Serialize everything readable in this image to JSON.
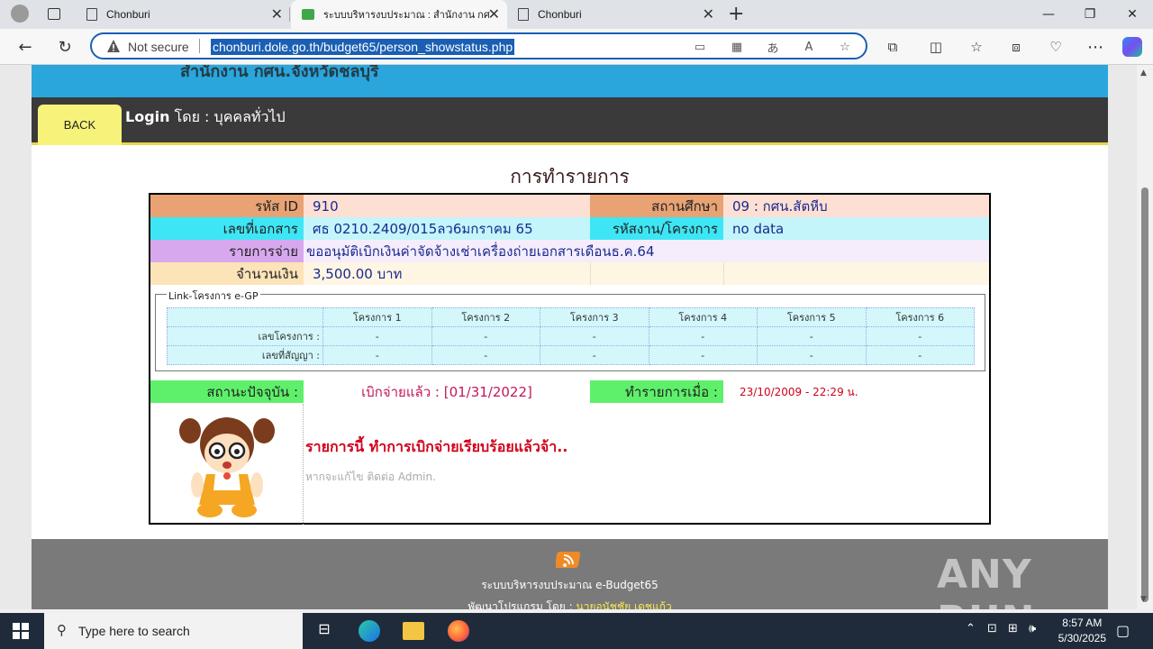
{
  "browser": {
    "tabs": [
      {
        "label": "Chonburi",
        "active": false
      },
      {
        "label": "ระบบบริหารงบประมาณ : สำนักงาน กศ.",
        "active": true
      },
      {
        "label": "Chonburi",
        "active": false
      }
    ],
    "not_secure": "Not secure",
    "url": "chonburi.dole.go.th/budget65/person_showstatus.php"
  },
  "page": {
    "header_partial": "สำนักงาน กศน.จังหวัดชลบุรี",
    "back": "BACK",
    "login_label": "Login",
    "login_by": "โดย : บุคคลทั่วไป",
    "title": "การทำรายการ",
    "fields": {
      "id_label": "รหัส ID",
      "id_value": "910",
      "school_label": "สถานศึกษา",
      "school_value": "09 : กศน.สัตหีบ",
      "doc_label": "เลขที่เอกสาร",
      "doc_value": "ศธ 0210.2409/015ลว6มกราคม 65",
      "project_label": "รหัสงาน/โครงการ",
      "project_value": "no data",
      "expense_label": "รายการจ่าย",
      "expense_value": "ขออนุมัติเบิกเงินค่าจัดจ้างเช่าเครื่องถ่ายเอกสารเดือนธ.ค.64",
      "amount_label": "จำนวนเงิน",
      "amount_value": "3,500.00  บาท"
    },
    "egp": {
      "legend": "Link-โครงการ e-GP",
      "headers": [
        "",
        "โครงการ 1",
        "โครงการ 2",
        "โครงการ 3",
        "โครงการ 4",
        "โครงการ 5",
        "โครงการ 6"
      ],
      "rows": [
        [
          "เลขโครงการ :",
          "-",
          "-",
          "-",
          "-",
          "-",
          "-"
        ],
        [
          "เลขที่สัญญา :",
          "-",
          "-",
          "-",
          "-",
          "-",
          "-"
        ]
      ]
    },
    "status": {
      "label": "สถานะปัจจุบัน :",
      "value": "เบิกจ่ายแล้ว : [01/31/2022]",
      "done_label": "ทำรายการเมื่อ :",
      "done_value": "23/10/2009 - 22:29  น."
    },
    "done_msg": "รายการนี้ ทำการเบิกจ่ายเรียบร้อยแล้วจ้า..",
    "admin_msg": "หากจะแก้ไข ติดต่อ Admin.",
    "footer_line1": "ระบบบริหารงบประมาณ e-Budget65",
    "footer_line2_prefix": "พัฒนาโปรแกรม โดย : ",
    "footer_line2_name": "นายอนัชชัย เดชแก้ว",
    "watermark": "ANY RUN"
  },
  "taskbar": {
    "search_placeholder": "Type here to search",
    "time": "8:57 AM",
    "date": "5/30/2025"
  },
  "colors": {
    "header_blue": "#2aa6dc",
    "label_orange": "#e8a273",
    "value_peach": "#fde0d3",
    "label_cyan": "#3ee6f5",
    "value_cyan": "#c3f5fb",
    "label_purple": "#d8a8ee",
    "value_lavender": "#f5edfc",
    "label_tan": "#fce3b8",
    "value_cream": "#fff5e3",
    "label_green": "#5ef06b"
  }
}
